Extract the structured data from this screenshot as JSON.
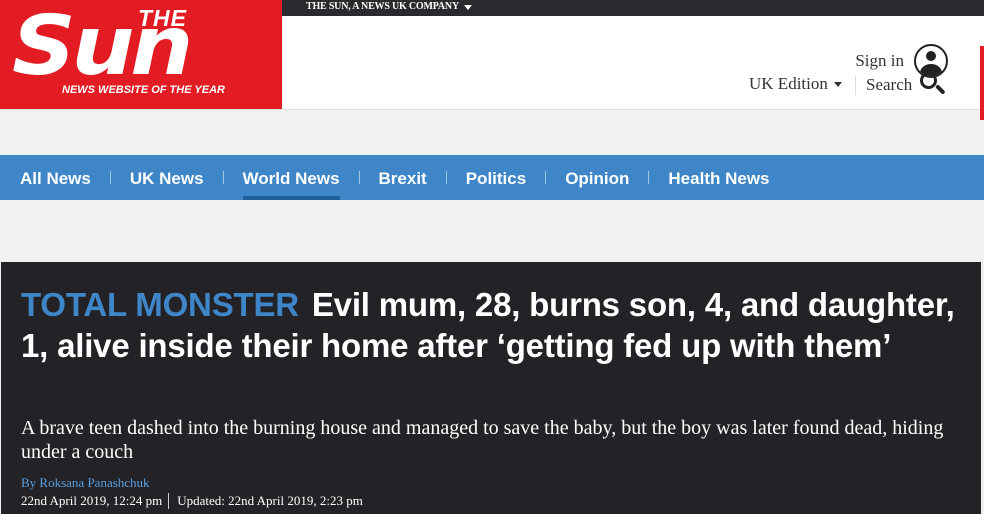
{
  "company_bar": {
    "label": "THE SUN, A NEWS UK COMPANY"
  },
  "logo": {
    "the": "THE",
    "name": "Sun",
    "tagline": "NEWS WEBSITE OF THE YEAR"
  },
  "header": {
    "sign_in": "Sign in",
    "edition": "UK Edition",
    "search": "Search"
  },
  "nav": {
    "items": [
      {
        "label": "All News"
      },
      {
        "label": "UK News"
      },
      {
        "label": "World News",
        "active": true
      },
      {
        "label": "Brexit"
      },
      {
        "label": "Politics"
      },
      {
        "label": "Opinion"
      },
      {
        "label": "Health News"
      }
    ]
  },
  "article": {
    "kicker": "TOTAL MONSTER",
    "headline": "Evil mum, 28, burns son, 4, and daughter, 1, alive inside their home after ‘getting fed up with them’",
    "standfirst": "A brave teen dashed into the burning house and managed to save the baby, but the boy was later found dead, hiding under a couch",
    "byline": "By Roksana Panashchuk",
    "published": "22nd April 2019, 12:24 pm",
    "updated": "Updated: 22nd April 2019, 2:23 pm"
  },
  "colors": {
    "brand_red": "#e31b23",
    "nav_blue": "#3f86c9",
    "card_bg": "#232327"
  }
}
